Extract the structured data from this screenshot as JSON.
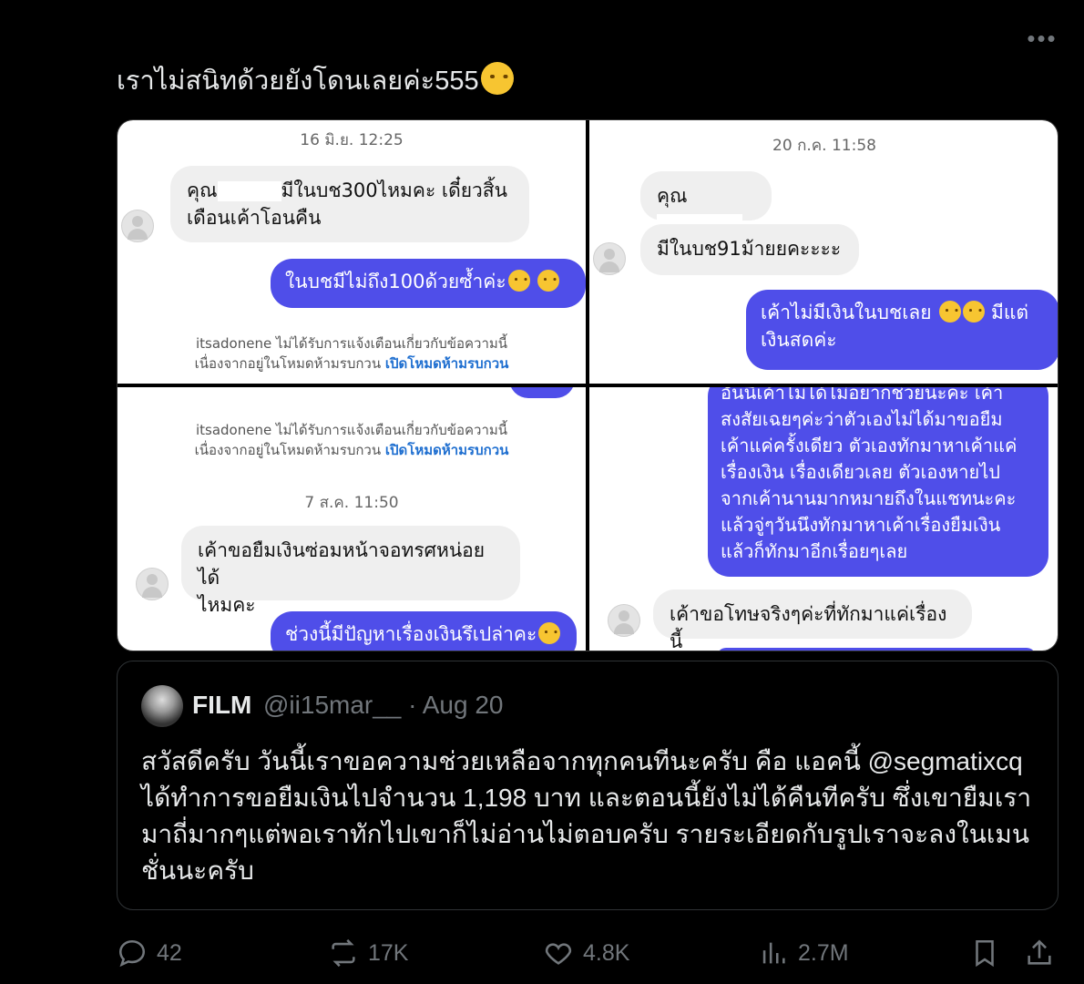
{
  "tweet": {
    "text": "เราไม่สนิทด้วยยังโดนเลยค่ะ555",
    "more_label": "•••"
  },
  "screenshots": {
    "p1": {
      "timestamp": "16 มิ.ย. 12:25",
      "in_msg_line1_a": "คุณ",
      "in_msg_line1_b": "มีในบช300ไหมคะ เดี๋ยวสิ้น",
      "in_msg_line2": "เดือนเค้าโอนคืน",
      "out_msg": "ในบชมีไม่ถึง100ด้วยซ้ำค่ะ",
      "notice_line1": "itsadonene ไม่ได้รับการแจ้งเตือนเกี่ยวกับข้อความนี้",
      "notice_line2": "เนื่องจากอยู่ในโหมดห้ามรบกวน",
      "notice_link": "เปิดโหมดห้ามรบกวน"
    },
    "p2": {
      "timestamp": "20 ก.ค. 11:58",
      "in_msg1": "คุณ",
      "in_msg2": "มีในบช91ม้ายยคะะะะ",
      "out_msg_line1": "เค้าไม่มีเงินในบชเลย",
      "out_msg_line1_b": "มีแต่",
      "out_msg_line2": "เงินสดค่ะ"
    },
    "p3": {
      "notice_line1": "itsadonene ไม่ได้รับการแจ้งเตือนเกี่ยวกับข้อความนี้",
      "notice_line2": "เนื่องจากอยู่ในโหมดห้ามรบกวน",
      "notice_link": "เปิดโหมดห้ามรบกวน",
      "timestamp": "7 ส.ค. 11:50",
      "in_msg_line1": "เค้าขอยืมเงินซ่อมหน้าจอทรศหน่อยได้",
      "in_msg_line2": "ไหมคะ",
      "out_msg": "ช่วงนี้มีปัญหาเรื่องเงินรึเปล่าคะ"
    },
    "p4": {
      "out_lines": [
        "อันนี้เค้าไม่ได้ไม่อยากช่วยนะคะ เค้า",
        "สงสัยเฉยๆค่ะว่าตัวเองไม่ได้มาขอยืม",
        "เค้าแค่ครั้งเดียว ตัวเองทักมาหาเค้าแค่",
        "เรื่องเงิน เรื่องเดียวเลย ตัวเองหายไป",
        "จากเค้านานมากหมายถึงในแชทนะคะ",
        "แล้วจู่ๆวันนึงทักมาหาเค้าเรื่องยืมเงิน",
        "แล้วก็ทักมาอีกเรื่อยๆเลย"
      ],
      "in_msg": "เค้าขอโทษจริงๆค่ะที่ทักมาแค่เรื่องนี้"
    }
  },
  "quote": {
    "name": "FILM",
    "handle": "@ii15mar__ · Aug 20",
    "text": "สวัสดีครับ วันนี้เราขอความช่วยเหลือจากทุกคนทีนะครับ คือ แอคนี้ @segmatixcq ได้ทำการขอยืมเงินไปจำนวน 1,198 บาท และตอนนี้ยังไม่ได้คืนทีครับ ซึ่งเขายืมเรามาถี่มากๆแต่พอเราทักไปเขาก็ไม่อ่านไม่ตอบครับ รายระเอียดกับรูปเราจะลงในเมนชั่นนะครับ"
  },
  "actions": {
    "replies": "42",
    "reposts": "17K",
    "likes": "4.8K",
    "views": "2.7M"
  },
  "colors": {
    "background": "#000000",
    "text": "#e7e9ea",
    "muted": "#71767b",
    "bubble_out": "#4f4ee9",
    "bubble_in": "#efefef"
  }
}
